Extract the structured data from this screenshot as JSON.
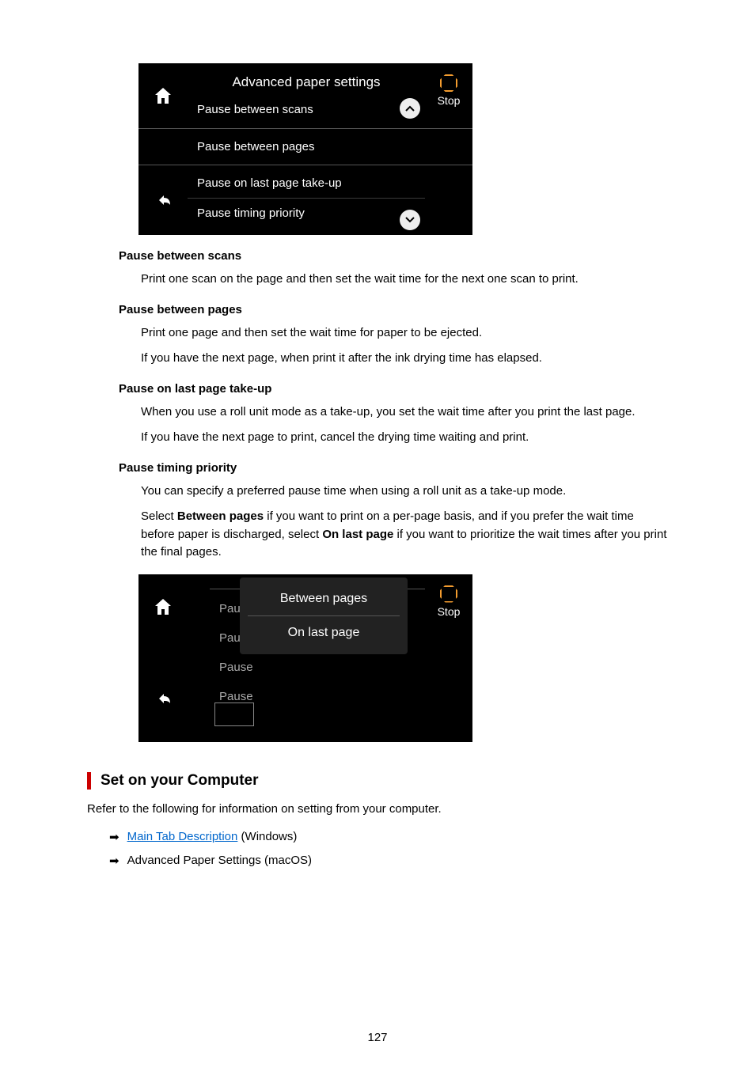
{
  "panel1": {
    "title": "Advanced paper settings",
    "items": [
      "Pause between scans",
      "Pause between pages",
      "Pause on last page take-up",
      "Pause timing priority"
    ],
    "stop": "Stop"
  },
  "defs": {
    "d1t": "Pause between scans",
    "d1b": "Print one scan on the page and then set the wait time for the next one scan to print.",
    "d2t": "Pause between pages",
    "d2b1": "Print one page and then set the wait time for paper to be ejected.",
    "d2b2": "If you have the next page, when print it after the ink drying time has elapsed.",
    "d3t": "Pause on last page take-up",
    "d3b1": "When you use a roll unit mode as a take-up, you set the wait time after you print the last page.",
    "d3b2": "If you have the next page to print, cancel the drying time waiting and print.",
    "d4t": "Pause timing priority",
    "d4b1": "You can specify a preferred pause time when using a roll unit as a take-up mode.",
    "d4b2a": "Select ",
    "d4b2b": "Between pages",
    "d4b2c": " if you want to print on a per-page basis, and if you prefer the wait time before paper is discharged, select ",
    "d4b2d": "On last page",
    "d4b2e": " if you want to prioritize the wait times after you print the final pages."
  },
  "panel2": {
    "bgItems": [
      "Pause",
      "Pause",
      "Pause",
      "Pause"
    ],
    "options": [
      "Between pages",
      "On last page"
    ],
    "stop": "Stop"
  },
  "section": {
    "title": "Set on your Computer",
    "intro": "Refer to the following for information on setting from your computer.",
    "link1": "Main Tab Description",
    "link1suffix": " (Windows)",
    "item2": "Advanced Paper Settings (macOS)"
  },
  "pageNumber": "127"
}
